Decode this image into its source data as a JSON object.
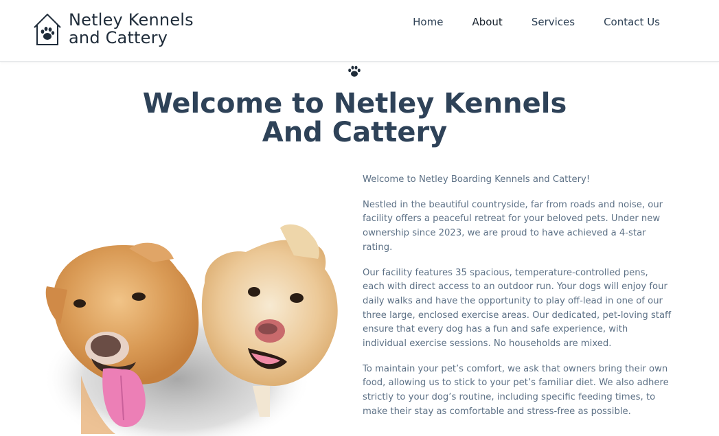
{
  "brand": {
    "line1": "Netley Kennels",
    "line2": "and Cattery"
  },
  "nav": {
    "items": [
      "Home",
      "About",
      "Services",
      "Contact Us"
    ],
    "active": "About"
  },
  "hero": {
    "title_line1": "Welcome to Netley Kennels",
    "title_line2": "And Cattery"
  },
  "content": {
    "paragraphs": [
      "Welcome to Netley Boarding Kennels and Cattery!",
      "Nestled in the beautiful countryside, far from roads and noise, our facility offers a peaceful retreat for your beloved pets. Under new ownership since 2023, we are proud to have achieved a 4-star rating.",
      "Our facility features 35 spacious, temperature-controlled pens, each with direct access to an outdoor run. Your dogs will enjoy four daily walks and have the opportunity to play off-lead in one of our three large, enclosed exercise areas. Our dedicated, pet-loving staff ensure that every dog has a fun and safe experience, with individual exercise sessions. No households are mixed.",
      "To maintain your pet’s comfort, we ask that owners bring their own food, allowing us to stick to your pet’s familiar diet. We also adhere strictly to your dog’s routine, including specific feeding times, to make their stay as comfortable and stress-free as possible."
    ]
  },
  "icons": {
    "logo": "house-paw-icon",
    "divider": "paw-icon"
  },
  "colors": {
    "heading": "#2e4258",
    "body_text": "#5d7186",
    "nav_text": "#2f4256"
  }
}
